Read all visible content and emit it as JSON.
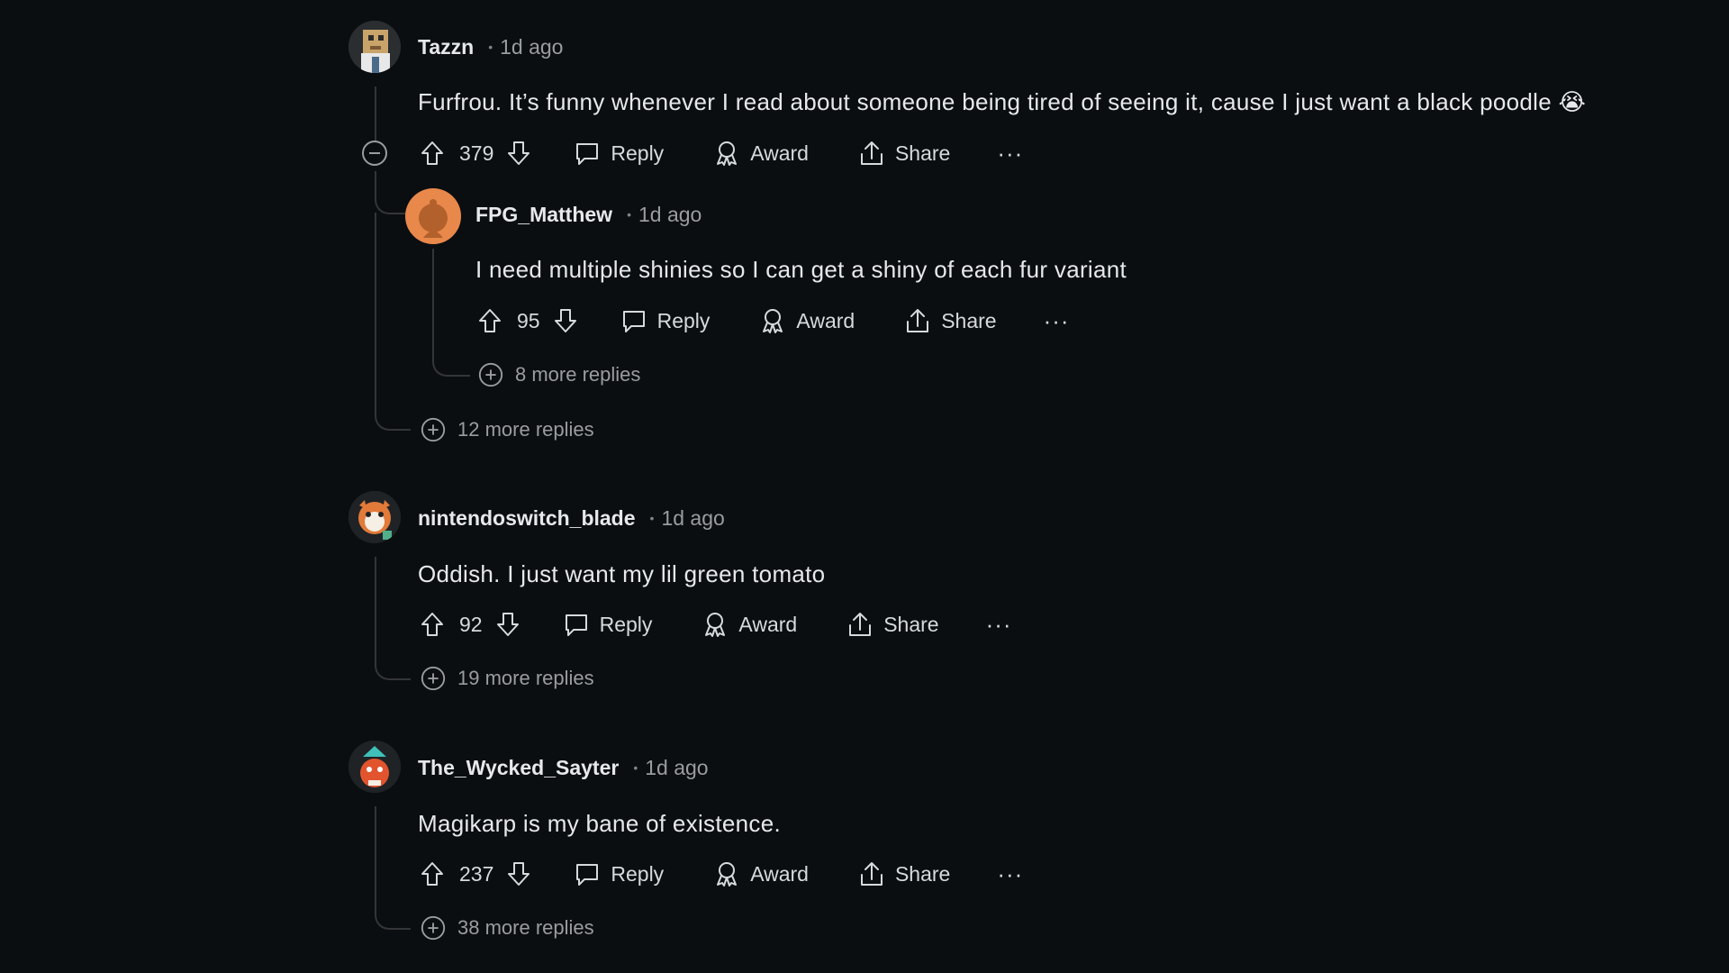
{
  "comments": [
    {
      "user": "Tazzn",
      "time": "1d ago",
      "text": "Furfrou. It’s funny whenever I read about someone being tired of seeing it, cause I just want a black poodle 😭",
      "votes": "379",
      "reply_label": "Reply",
      "award_label": "Award",
      "share_label": "Share",
      "more_replies": "12 more replies"
    },
    {
      "user": "FPG_Matthew",
      "time": "1d ago",
      "text": "I need multiple shinies so I can get a shiny of each fur variant",
      "votes": "95",
      "reply_label": "Reply",
      "award_label": "Award",
      "share_label": "Share",
      "more_replies": "8 more replies"
    },
    {
      "user": "nintendoswitch_blade",
      "time": "1d ago",
      "text": "Oddish. I just want my lil green tomato",
      "votes": "92",
      "reply_label": "Reply",
      "award_label": "Award",
      "share_label": "Share",
      "more_replies": "19 more replies"
    },
    {
      "user": "The_Wycked_Sayter",
      "time": "1d ago",
      "text": "Magikarp is my bane of existence.",
      "votes": "237",
      "reply_label": "Reply",
      "award_label": "Award",
      "share_label": "Share",
      "more_replies": "38 more replies"
    }
  ],
  "icons": {
    "upvote": "upvote-icon",
    "downvote": "downvote-icon",
    "reply": "comment-bubble-icon",
    "award": "award-ribbon-icon",
    "share": "share-upload-icon",
    "more": "ellipsis-icon",
    "expand": "plus-circle-icon",
    "collapse": "minus-circle-icon"
  },
  "colors": {
    "background": "#0b0e11",
    "text": "#d7dadc",
    "muted": "#9a9c9e",
    "thread_line": "#343536",
    "avatar_orange": "#e8884a"
  }
}
